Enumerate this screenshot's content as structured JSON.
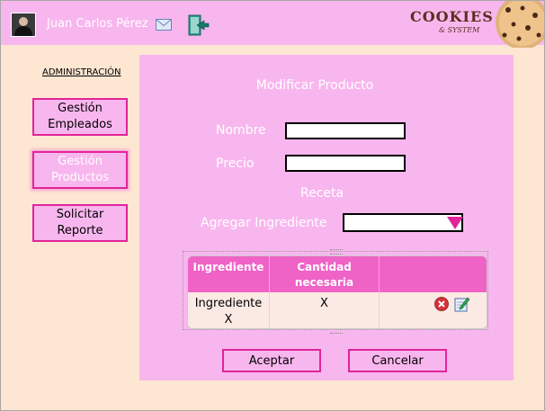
{
  "header": {
    "user_name": "Juan Carlos Pérez",
    "icons": [
      "user-avatar",
      "mail-icon",
      "logout-icon"
    ],
    "logo": {
      "title": "COOKIES",
      "subtitle": "& SYSTEM"
    }
  },
  "sidebar": {
    "title": "ADMINISTRACIÓN",
    "items": [
      {
        "label_line1": "Gestión",
        "label_line2": "Empleados",
        "active": false
      },
      {
        "label_line1": "Gestión",
        "label_line2": "Productos",
        "active": true
      },
      {
        "label_line1": "Solicitar",
        "label_line2": "Reporte",
        "active": false
      }
    ]
  },
  "form": {
    "title": "Modificar Producto",
    "nombre_label": "Nombre",
    "nombre_value": "",
    "precio_label": "Precio",
    "precio_value": "",
    "receta_label": "Receta",
    "agregar_label": "Agregar Ingrediente",
    "agregar_value": ""
  },
  "table": {
    "headers": [
      {
        "line1": "Ingrediente",
        "line2": ""
      },
      {
        "line1": "Cantidad",
        "line2": "necesaria"
      },
      {
        "line1": "",
        "line2": ""
      }
    ],
    "rows": [
      {
        "ingrediente_line1": "Ingrediente",
        "ingrediente_line2": "X",
        "cantidad": "X",
        "actions": [
          "delete-icon",
          "edit-icon"
        ]
      }
    ]
  },
  "buttons": {
    "aceptar": "Aceptar",
    "cancelar": "Cancelar"
  },
  "colors": {
    "header_bg": "#f8b6ee",
    "page_bg": "#fde6d2",
    "accent_border": "#e0249a",
    "table_header": "#ef62c6"
  }
}
